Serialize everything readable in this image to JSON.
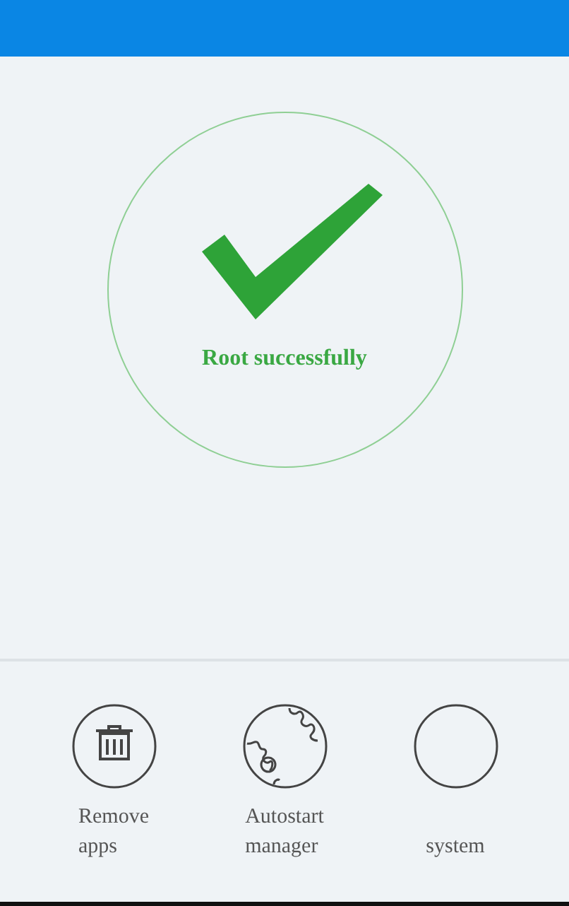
{
  "status": {
    "message": "Root successfully"
  },
  "actions": [
    {
      "kind": "trash",
      "label_lines": [
        "Remove",
        "apps"
      ]
    },
    {
      "kind": "gears",
      "label_lines": [
        "Autostart",
        "manager"
      ]
    },
    {
      "kind": "empty",
      "label_lines": [
        "system"
      ]
    }
  ]
}
